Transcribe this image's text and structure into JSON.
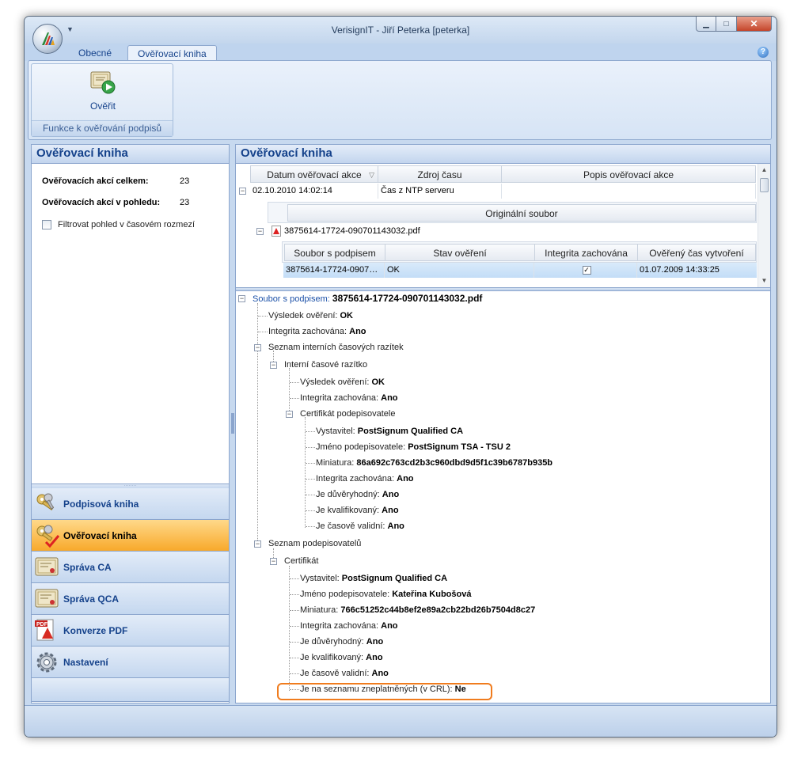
{
  "window": {
    "title": "VerisignIT - Jiří Peterka [peterka]"
  },
  "colors": {
    "accent": "#15428b",
    "highlight": "#f07c1e",
    "active_nav": "#f8a92b"
  },
  "ribbon": {
    "tabs": [
      {
        "label": "Obecné"
      },
      {
        "label": "Ověřovací kniha"
      }
    ],
    "verify_button": "Ověřit",
    "group_caption": "Funkce k ověřování podpisů"
  },
  "left": {
    "title": "Ověřovací kniha",
    "stats": [
      {
        "label": "Ověřovacích akcí celkem:",
        "value": "23"
      },
      {
        "label": "Ověřovacích akcí v pohledu:",
        "value": "23"
      }
    ],
    "filter_label": "Filtrovat pohled v časovém rozmezí",
    "filter_checked": false,
    "nav": [
      {
        "label": "Podpisová kniha",
        "icon": "keys-icon"
      },
      {
        "label": "Ověřovací kniha",
        "icon": "keys-check-icon",
        "active": true
      },
      {
        "label": "Správa CA",
        "icon": "certificate-icon"
      },
      {
        "label": "Správa QCA",
        "icon": "certificate-icon"
      },
      {
        "label": "Konverze PDF",
        "icon": "pdf-adobe-icon"
      },
      {
        "label": "Nastavení",
        "icon": "gear-icon"
      }
    ]
  },
  "right": {
    "title": "Ověřovací kniha",
    "grid": {
      "columns": [
        "Datum ověřovací akce",
        "Zdroj času",
        "Popis ověřovací akce"
      ],
      "row": {
        "date": "02.10.2010 14:02:14",
        "source": "Čas z NTP serveru",
        "desc": ""
      },
      "orig_header": "Originální soubor",
      "orig_file": "3875614-17724-090701143032.pdf",
      "sub_columns": [
        "Soubor s podpisem",
        "Stav ověření",
        "Integrita zachována",
        "Ověřený čas vytvoření"
      ],
      "sub_row": {
        "file": "3875614-17724-0907…",
        "status": "OK",
        "integrity": true,
        "created": "01.07.2009 14:33:25"
      }
    },
    "tree": {
      "root_label": "Soubor s podpisem:",
      "root_value": "3875614-17724-090701143032.pdf",
      "result_label": "Výsledek ověření:",
      "result_value": "OK",
      "integrity_label": "Integrita zachována:",
      "integrity_value": "Ano",
      "internal_list": "Seznam interních časových razítek",
      "internal_stamp": "Interní časové razítko",
      "stamp_result_label": "Výsledek ověření:",
      "stamp_result_value": "OK",
      "stamp_integrity_label": "Integrita zachována:",
      "stamp_integrity_value": "Ano",
      "signer_cert": "Certifikát podepisovatele",
      "tsa": {
        "issuer_label": "Vystavitel:",
        "issuer_value": "PostSignum Qualified CA",
        "name_label": "Jméno podepisovatele:",
        "name_value": "PostSignum TSA - TSU 2",
        "thumb_label": "Miniatura:",
        "thumb_value": "86a692c763cd2b3c960dbd9d5f1c39b6787b935b",
        "integ_label": "Integrita zachována:",
        "integ_value": "Ano",
        "trusted_label": "Je důvěryhodný:",
        "trusted_value": "Ano",
        "qualified_label": "Je kvalifikovaný:",
        "qualified_value": "Ano",
        "valid_label": "Je časově validní:",
        "valid_value": "Ano"
      },
      "signers_list": "Seznam podepisovatelů",
      "certificate": "Certifikát",
      "signer": {
        "issuer_label": "Vystavitel:",
        "issuer_value": "PostSignum Qualified CA",
        "name_label": "Jméno podepisovatele:",
        "name_value": "Kateřina Kubošová",
        "thumb_label": "Miniatura:",
        "thumb_value": "766c51252c44b8ef2e89a2cb22bd26b7504d8c27",
        "integ_label": "Integrita zachována:",
        "integ_value": "Ano",
        "trusted_label": "Je důvěryhodný:",
        "trusted_value": "Ano",
        "qualified_label": "Je kvalifikovaný:",
        "qualified_value": "Ano",
        "valid_label": "Je časově validní:",
        "valid_value": "Ano",
        "crl_label": "Je na seznamu zneplatněných (v CRL):",
        "crl_value": "Ne"
      }
    }
  }
}
